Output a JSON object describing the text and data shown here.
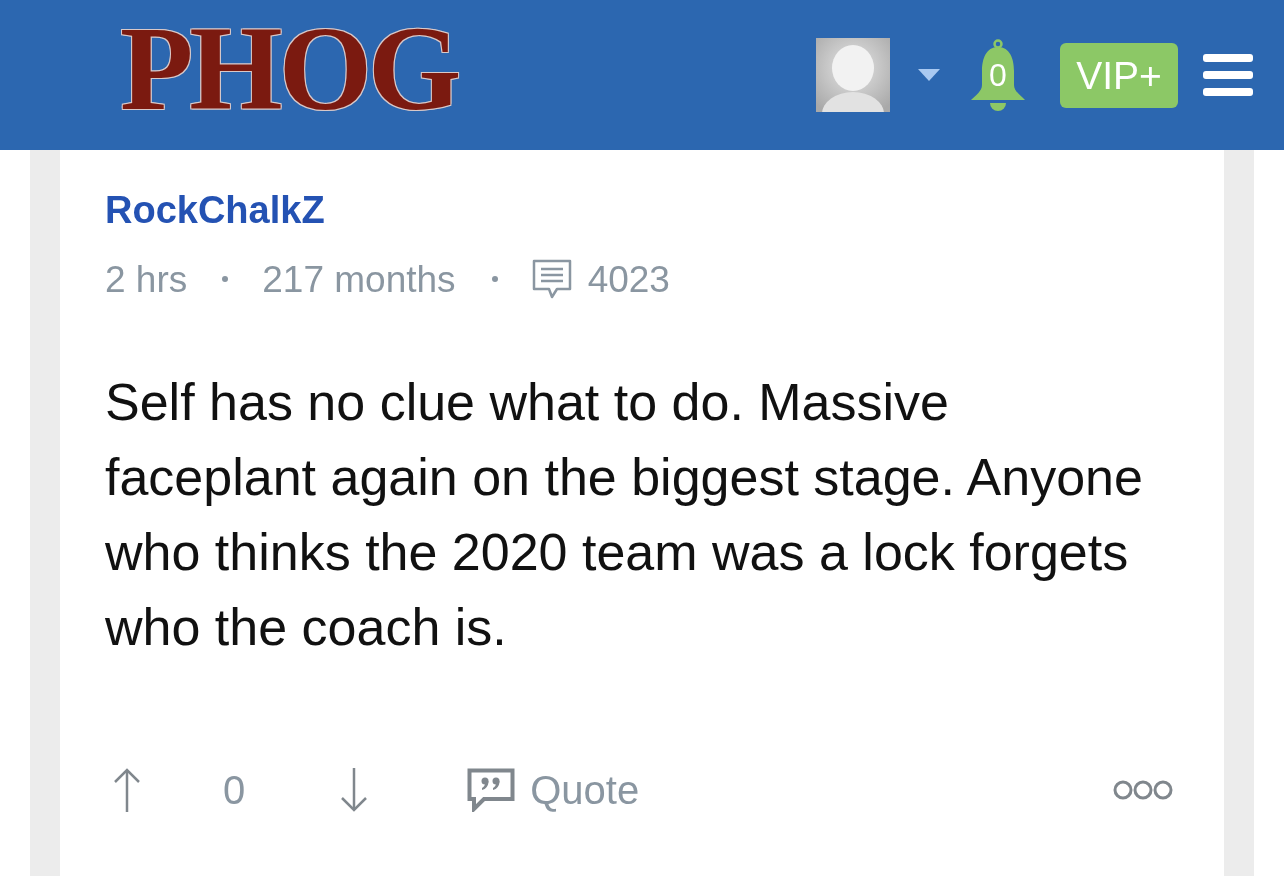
{
  "header": {
    "logo": "PHOG",
    "notification_count": "0",
    "vip_button": "VIP+"
  },
  "post": {
    "author": "RockChalkZ",
    "time": "2 hrs",
    "member_for": "217 months",
    "post_count": "4023",
    "body": "Self has no clue what to do. Massive faceplant again on the biggest stage. Anyone who thinks the 2020 team was a lock forgets who the coach is.",
    "score": "0",
    "quote_button": "Quote"
  }
}
